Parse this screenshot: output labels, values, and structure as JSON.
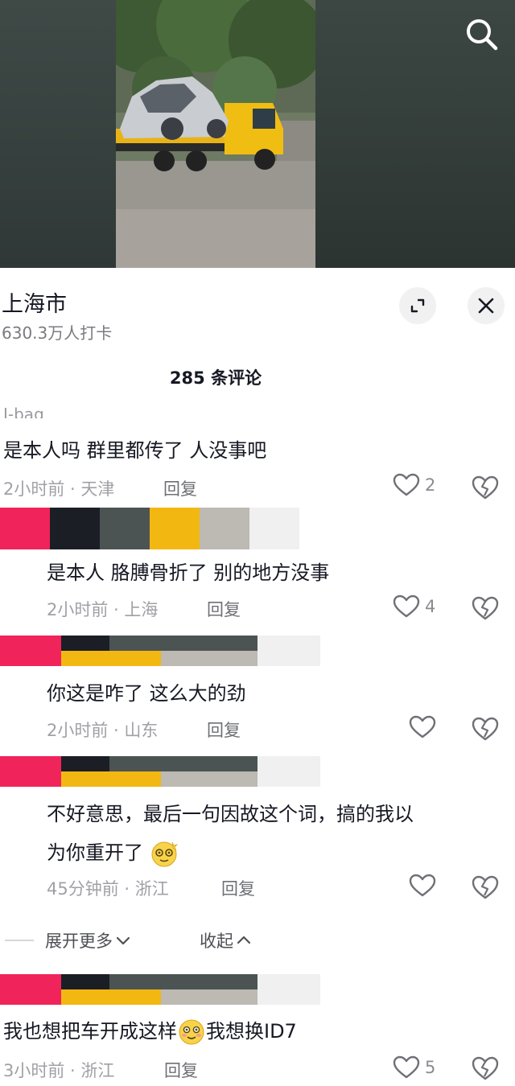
{
  "header": {
    "location": "上海市",
    "checkins": "630.3万人打卡",
    "comment_count": "285 条评论"
  },
  "icons": {
    "search": "search-icon",
    "expand": "expand-icon",
    "close": "close-icon",
    "like": "heart-outline-icon",
    "dislike": "broken-heart-icon",
    "emoji_blush": "shy-smile-emoji-icon",
    "emoji_dizzy": "dizzy-face-emoji-icon"
  },
  "comments": [
    {
      "partial_name": "I-bag",
      "text": "是本人吗  群里都传了  人没事吧",
      "meta": "2小时前 · 天津",
      "reply": "回复",
      "likes": "2"
    },
    {
      "text": "是本人  胳膊骨折了 别的地方没事",
      "meta": "2小时前 · 上海",
      "reply": "回复",
      "likes": "4"
    },
    {
      "text": "你这是咋了  这么大的劲",
      "meta": "2小时前 · 山东",
      "reply": "回复",
      "likes": ""
    },
    {
      "text_line1": "不好意思，最后一句因故这个词，搞的我以",
      "text_line2": "为你重开了",
      "meta": "45分钟前 · 浙江",
      "reply": "回复",
      "likes": ""
    },
    {
      "text_part1": "我也想把车开成这样",
      "text_part2": "我想换ID7",
      "meta": "3小时前 · 浙江",
      "reply": "回复",
      "likes": "5"
    }
  ],
  "thread": {
    "expand_more": "展开更多",
    "collapse": "收起"
  },
  "colors": {
    "redact_pink": "#f0245a",
    "redact_dark": "#1c1e26",
    "redact_slate": "#4b5452",
    "redact_yellow": "#f3b712",
    "redact_gray": "#bdb9b3",
    "redact_light": "#f0f0f0"
  }
}
